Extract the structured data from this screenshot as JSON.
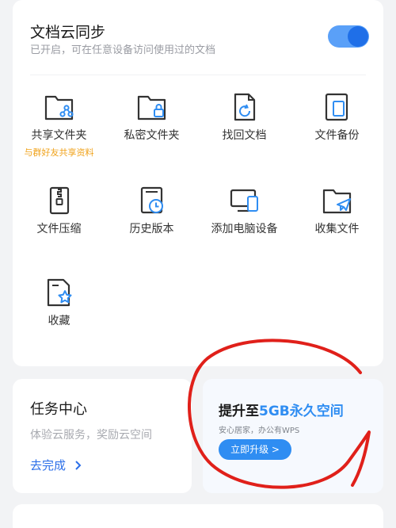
{
  "sync": {
    "title": "文档云同步",
    "subtitle": "已开启，可在任意设备访问使用过的文档",
    "toggle_on": true
  },
  "grid": [
    {
      "name": "grid-item-shared-folder",
      "icon": "shared-folder-icon",
      "label": "共享文件夹",
      "note": "与群好友共享资料"
    },
    {
      "name": "grid-item-private-folder",
      "icon": "private-folder-icon",
      "label": "私密文件夹"
    },
    {
      "name": "grid-item-recover-doc",
      "icon": "recover-doc-icon",
      "label": "找回文档"
    },
    {
      "name": "grid-item-file-backup",
      "icon": "file-backup-icon",
      "label": "文件备份"
    },
    {
      "name": "grid-item-file-compress",
      "icon": "zip-file-icon",
      "label": "文件压缩"
    },
    {
      "name": "grid-item-history-version",
      "icon": "history-clock-icon",
      "label": "历史版本"
    },
    {
      "name": "grid-item-add-pc",
      "icon": "computer-phone-icon",
      "label": "添加电脑设备"
    },
    {
      "name": "grid-item-collect-files",
      "icon": "send-folder-icon",
      "label": "收集文件"
    },
    {
      "name": "grid-item-favorites",
      "icon": "star-doc-icon",
      "label": "收藏"
    }
  ],
  "task": {
    "title": "任务中心",
    "subtitle": "体验云服务，奖励云空间",
    "link": "去完成"
  },
  "promo": {
    "title_prefix": "提升至",
    "title_highlight": "5GB永久空间",
    "subtitle": "安心居家，办公有WPS",
    "button": "立即升级 >"
  },
  "colors": {
    "accent": "#2f8df2",
    "link": "#2c6fe8",
    "note": "#f0a21a",
    "annotation": "#e0201a"
  }
}
